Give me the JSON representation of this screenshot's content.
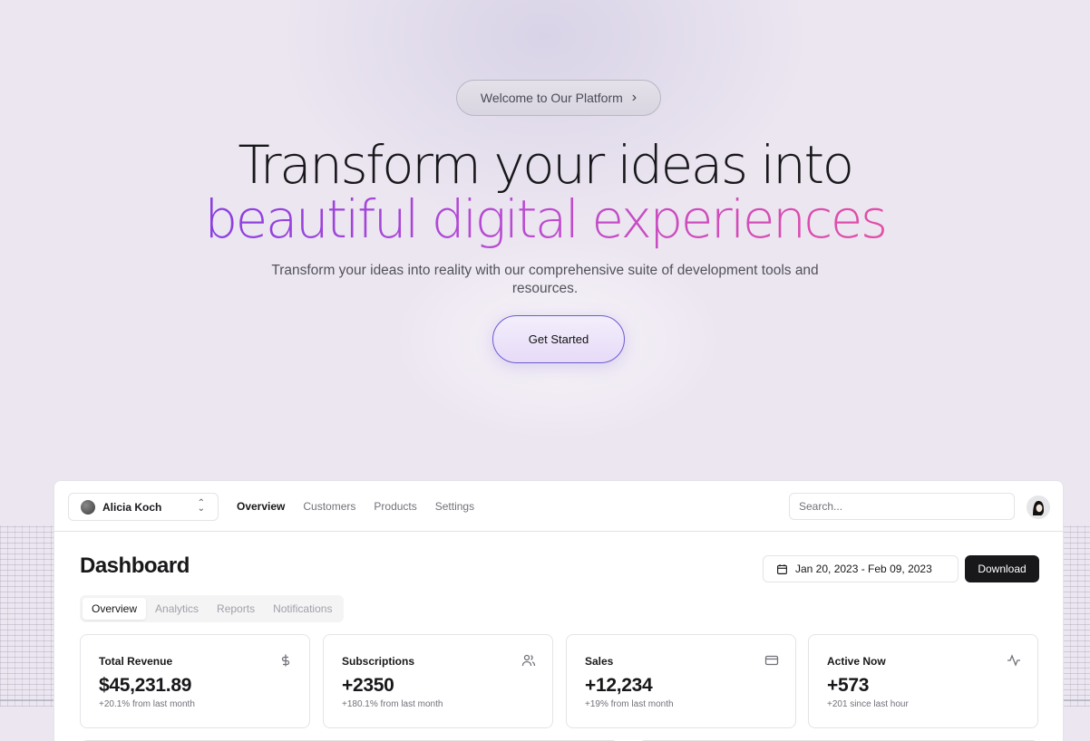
{
  "hero": {
    "badge_label": "Welcome to Our Platform",
    "headline_line1": "Transform your ideas into",
    "headline_line2": "beautiful digital experiences",
    "subtitle": "Transform your ideas into reality with our comprehensive suite of development tools and resources.",
    "cta_label": "Get Started",
    "gradient_colors": [
      "#8a3fe0",
      "#b94bd2",
      "#e24ea6"
    ]
  },
  "dashboard": {
    "team_switcher": {
      "name": "Alicia Koch"
    },
    "nav_links": [
      "Overview",
      "Customers",
      "Products",
      "Settings"
    ],
    "active_nav": "Overview",
    "search": {
      "placeholder": "Search..."
    },
    "title": "Dashboard",
    "date_range": "Jan 20, 2023 - Feb 09, 2023",
    "download_label": "Download",
    "tabs": [
      "Overview",
      "Analytics",
      "Reports",
      "Notifications"
    ],
    "active_tab": "Overview",
    "stats": [
      {
        "label": "Total Revenue",
        "value": "$45,231.89",
        "change": "+20.1% from last month",
        "icon": "dollar-icon"
      },
      {
        "label": "Subscriptions",
        "value": "+2350",
        "change": "+180.1% from last month",
        "icon": "users-icon"
      },
      {
        "label": "Sales",
        "value": "+12,234",
        "change": "+19% from last month",
        "icon": "credit-card-icon"
      },
      {
        "label": "Active Now",
        "value": "+573",
        "change": "+201 since last hour",
        "icon": "activity-icon"
      }
    ]
  }
}
